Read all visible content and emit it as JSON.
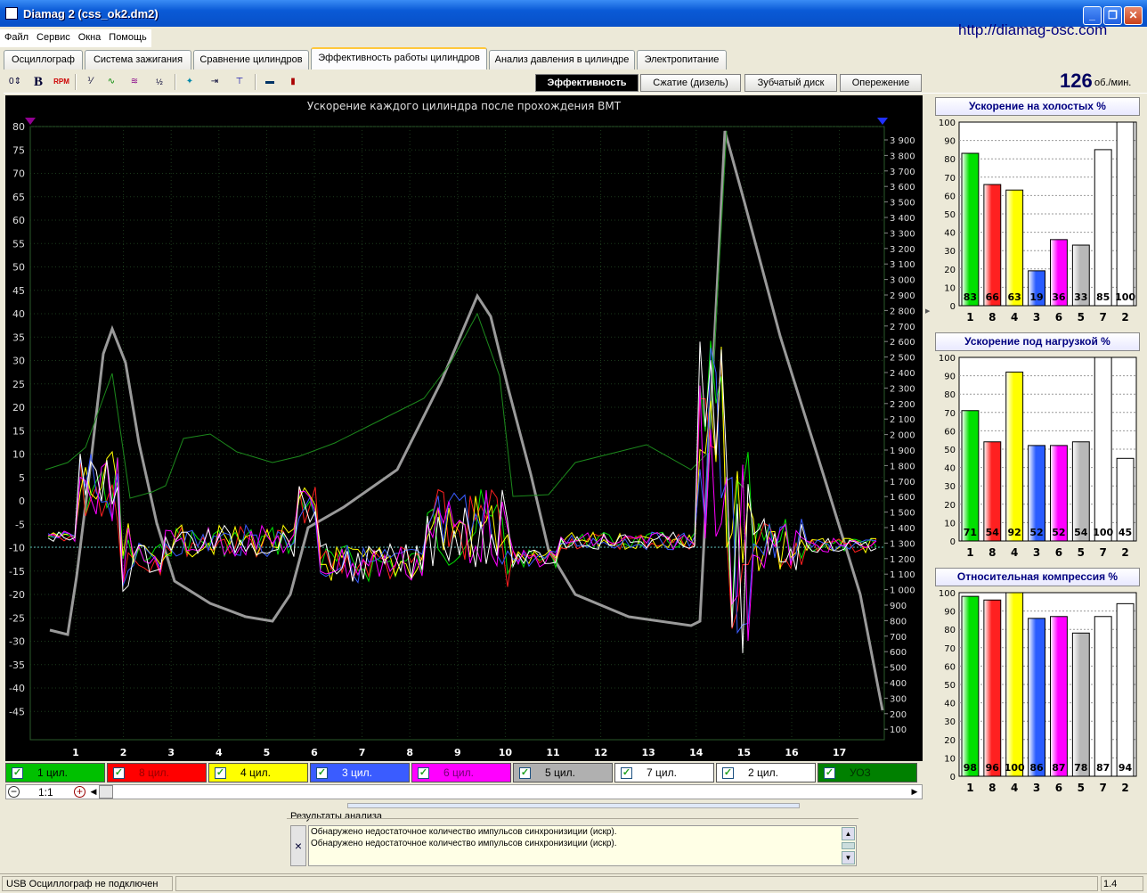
{
  "window": {
    "title": "Diamag 2 (css_ok2.dm2)",
    "url": "http://diamag-osc.com"
  },
  "menu": [
    "Файл",
    "Сервис",
    "Окна",
    "Помощь"
  ],
  "tabs": [
    {
      "label": "Осциллограф",
      "active": false
    },
    {
      "label": "Система зажигания",
      "active": false
    },
    {
      "label": "Сравнение цилиндров",
      "active": false
    },
    {
      "label": "Эффективность работы цилиндров",
      "active": true
    },
    {
      "label": "Анализ давления в цилиндре",
      "active": false
    },
    {
      "label": "Электропитание",
      "active": false
    }
  ],
  "toolbar": {
    "zero_label": "0",
    "bold_label": "B",
    "rpm_label": "RPM",
    "tools": [
      "scale-icon",
      "sine-icon",
      "vvti-icon",
      "algo-icon",
      "sensor-icon",
      "numbering-icon",
      "fit-icon",
      "car-icon",
      "bars-icon"
    ]
  },
  "view_buttons": [
    {
      "label": "Эффективность",
      "active": true
    },
    {
      "label": "Сжатие (дизель)",
      "active": false
    },
    {
      "label": "Зубчатый диск",
      "active": false
    },
    {
      "label": "Опережение",
      "active": false
    }
  ],
  "rpm": {
    "value": "126",
    "unit": "об./мин."
  },
  "main_chart": {
    "title": "Ускорение каждого цилиндра после прохождения ВМТ",
    "left_ticks": [
      "80",
      "75",
      "70",
      "65",
      "60",
      "55",
      "50",
      "45",
      "40",
      "35",
      "30",
      "25",
      "20",
      "15",
      "10",
      "5",
      "0",
      "-5",
      "-10",
      "-15",
      "-20",
      "-25",
      "-30",
      "-35",
      "-40",
      "-45"
    ],
    "right_ticks": [
      "3 900",
      "3 800",
      "3 700",
      "3 600",
      "3 500",
      "3 400",
      "3 300",
      "3 200",
      "3 100",
      "3 000",
      "2 900",
      "2 800",
      "2 700",
      "2 600",
      "2 500",
      "2 400",
      "2 300",
      "2 200",
      "2 100",
      "2 000",
      "1 900",
      "1 800",
      "1 700",
      "1 600",
      "1 500",
      "1 400",
      "1 300",
      "1 200",
      "1 100",
      "1 000",
      "900",
      "800",
      "700",
      "600",
      "500",
      "400",
      "300",
      "200",
      "100"
    ],
    "x_ticks": [
      "1",
      "2",
      "3",
      "4",
      "5",
      "6",
      "7",
      "8",
      "9",
      "10",
      "11",
      "12",
      "13",
      "14",
      "15",
      "16",
      "17"
    ]
  },
  "legend": [
    {
      "label": "1 цил.",
      "color": "#00c000",
      "text": "#000"
    },
    {
      "label": "8 цил.",
      "color": "#ff0000",
      "text": "#900"
    },
    {
      "label": "4 цил.",
      "color": "#ffff00",
      "text": "#000"
    },
    {
      "label": "3 цил.",
      "color": "#3a5cff",
      "text": "#fff"
    },
    {
      "label": "6 цил.",
      "color": "#ff00ff",
      "text": "#700070"
    },
    {
      "label": "5 цил.",
      "color": "#b0b0b0",
      "text": "#000"
    },
    {
      "label": "7 цил.",
      "color": "#ffffff",
      "text": "#000"
    },
    {
      "label": "2 цил.",
      "color": "#ffffff",
      "text": "#000"
    },
    {
      "label": "УОЗ",
      "color": "#008000",
      "text": "#003000"
    }
  ],
  "zoom": {
    "value": "1:1"
  },
  "analysis": {
    "header": "Результаты анализа",
    "messages": [
      "Обнаружено недостаточное количество импульсов синхронизиции (искр).",
      "Обнаружено недостаточное количество импульсов синхронизиции (искр)."
    ],
    "close_glyph": "×"
  },
  "status": {
    "left": "USB Осциллограф не подключен",
    "right": "1.4"
  },
  "chart_data": [
    {
      "type": "bar",
      "title": "Ускорение на холостых %",
      "categories": [
        "1",
        "8",
        "4",
        "3",
        "6",
        "5",
        "7",
        "2"
      ],
      "values": [
        83,
        66,
        63,
        19,
        36,
        33,
        85,
        100
      ],
      "ylim": [
        0,
        100
      ],
      "yticks": [
        "100",
        "90",
        "80",
        "70",
        "60",
        "50",
        "40",
        "30",
        "20",
        "10",
        "0"
      ]
    },
    {
      "type": "bar",
      "title": "Ускорение под нагрузкой %",
      "categories": [
        "1",
        "8",
        "4",
        "3",
        "6",
        "5",
        "7",
        "2"
      ],
      "values": [
        71,
        54,
        92,
        52,
        52,
        54,
        100,
        45
      ],
      "ylim": [
        0,
        100
      ],
      "yticks": [
        "100",
        "90",
        "80",
        "70",
        "60",
        "50",
        "40",
        "30",
        "20",
        "10",
        "0"
      ]
    },
    {
      "type": "bar",
      "title": "Относительная компрессия %",
      "categories": [
        "1",
        "8",
        "4",
        "3",
        "6",
        "5",
        "7",
        "2"
      ],
      "values": [
        98,
        96,
        100,
        86,
        87,
        78,
        87,
        94
      ],
      "ylim": [
        0,
        100
      ],
      "yticks": [
        "100",
        "90",
        "80",
        "70",
        "60",
        "50",
        "40",
        "30",
        "20",
        "10",
        "0"
      ]
    }
  ],
  "bar_colors": [
    "#00e000",
    "#ff2020",
    "#ffff00",
    "#2a5cff",
    "#ff00ff",
    "#b8b8b8",
    "#ffffff",
    "#ffffff"
  ]
}
